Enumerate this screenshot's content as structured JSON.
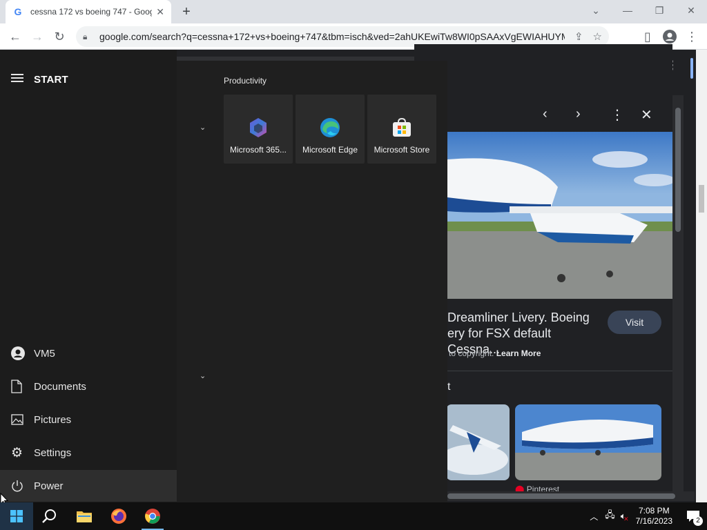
{
  "browser": {
    "tab_title": "cessna 172 vs boeing 747 - Goog",
    "url": "google.com/search?q=cessna+172+vs+boeing+747&tbm=isch&ved=2ahUKEwiTw8WI0pSAAxVgEWIAHUYMCbI..."
  },
  "image_panel": {
    "title": "Dreamliner Livery. Boeing ... ery for FSX default Cessna...",
    "title_line1": "Dreamliner Livery. Boeing",
    "title_line2": "ery for FSX default Cessna...",
    "visit_label": "Visit",
    "copyright_prefix": "to copyright.",
    "learn_more": "Learn More",
    "related_heading": "t",
    "thumb2_source": "Pinterest"
  },
  "start_menu": {
    "title": "START",
    "group_label": "Productivity",
    "tiles": [
      {
        "label": "Microsoft 365...",
        "icon": "microsoft-365-icon"
      },
      {
        "label": "Microsoft Edge",
        "icon": "edge-icon"
      },
      {
        "label": "Microsoft Store",
        "icon": "store-icon"
      }
    ],
    "rail": [
      {
        "label": "VM5",
        "icon": "user-icon"
      },
      {
        "label": "Documents",
        "icon": "document-icon"
      },
      {
        "label": "Pictures",
        "icon": "pictures-icon"
      },
      {
        "label": "Settings",
        "icon": "gear-icon"
      },
      {
        "label": "Power",
        "icon": "power-icon"
      }
    ]
  },
  "taskbar": {
    "time": "7:08 PM",
    "date": "7/16/2023",
    "notification_count": "2",
    "apps": [
      "windows-start-icon",
      "search-icon",
      "file-explorer-icon",
      "firefox-icon",
      "chrome-icon"
    ]
  },
  "colors": {
    "accent": "#76b9ed",
    "start_bg": "#1f1f1f",
    "page_bg": "#202124"
  }
}
